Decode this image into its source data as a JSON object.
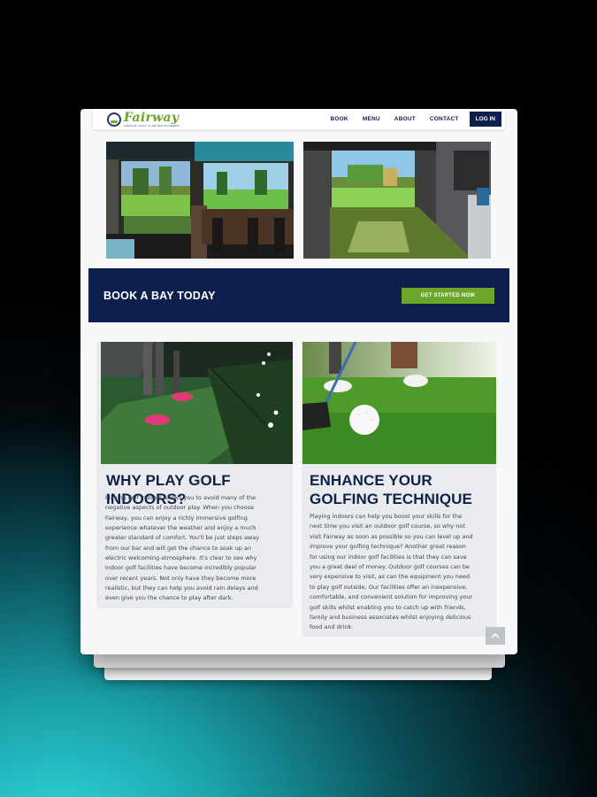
{
  "nav": {
    "logo_text": "Fairway",
    "logo_tagline": "INDOOR GOLF & ENTERTAINMENT",
    "links": [
      "BOOK",
      "MENU",
      "ABOUT",
      "CONTACT"
    ],
    "login_label": "LOG IN"
  },
  "banner": {
    "title": "BOOK A BAY TODAY",
    "button_label": "GET STARTED NOW"
  },
  "cards": [
    {
      "title_lines": [
        "WHY PLAY GOLF INDOORS?"
      ],
      "text_lines": [
        "Playing golf indoors allows you to avoid many of the",
        "negative aspects of outdoor play. When you choose",
        "Fairway, you can enjoy a richly immersive golfing",
        "experience whatever the weather and enjoy a much",
        "greater standard of comfort. You'll be just steps away",
        "from our bar and will get the chance to soak up an",
        "electric welcoming atmosphere. It's clear to see why",
        "indoor golf facilities have become incredibly popular",
        "over recent years. Not only have they become more",
        "realistic, but they can help you avoid rain delays and",
        "even give you the chance to play after dark."
      ]
    },
    {
      "title_lines": [
        "ENHANCE YOUR",
        "GOLFING TECHNIQUE"
      ],
      "text_lines": [
        "Playing indoors can help you boost your skills for the",
        "next time you visit an outdoor golf course, so why not",
        "visit Fairway as soon as possible so you can level up and",
        "improve your golfing technique? Another great reason",
        "for using our indoor golf facilities is that they can save",
        "you a great deal of money. Outdoor golf courses can be",
        "very expensive to visit, as can the equipment you need",
        "to play golf outside. Our facilities offer an inexpensive,",
        "comfortable, and convenient solution for improving your",
        "golf skills whilst enabling you to catch up with friends,",
        "family and business associates whilst enjoying delicious",
        "food and drink."
      ]
    }
  ],
  "icons": {
    "logo": "golf-ball-logo-icon",
    "scroll_top": "chevron-up-icon"
  },
  "colors": {
    "navy": "#0c1f4d",
    "green": "#6ba52a"
  }
}
